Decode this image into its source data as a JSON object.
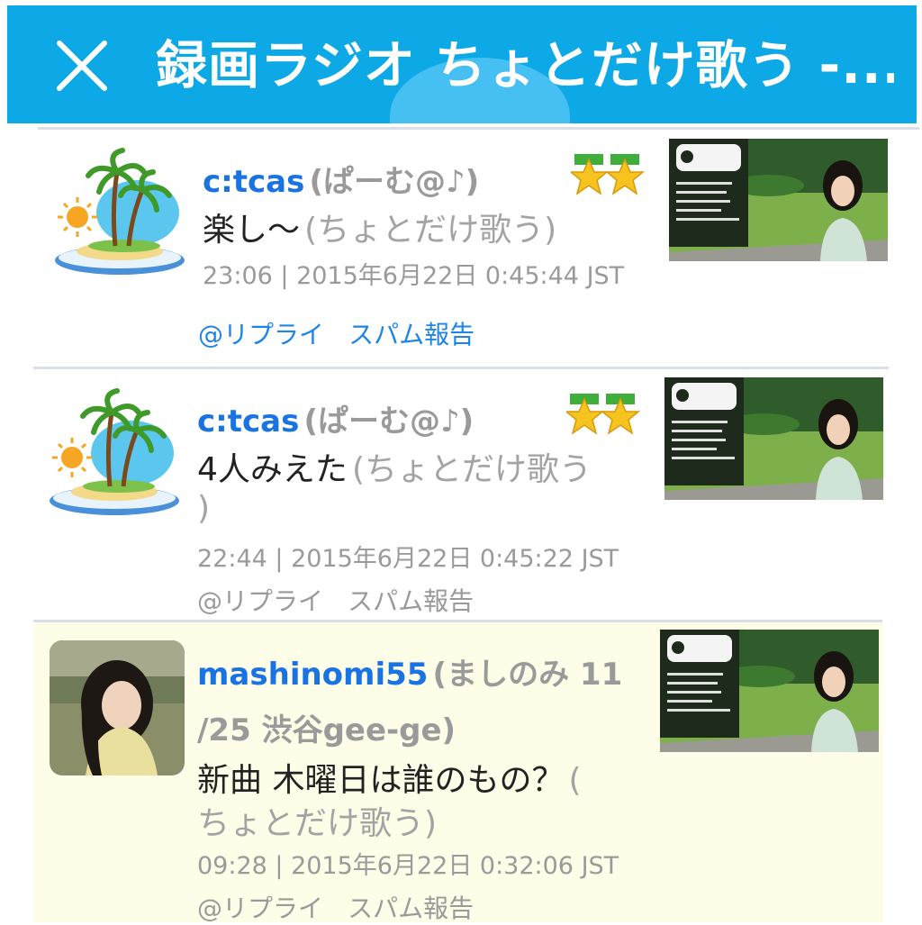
{
  "header": {
    "title": "録画ラジオ ちょとだけ歌う -...",
    "close_icon": "close-icon",
    "bg_color": "#0da8e6"
  },
  "feed": [
    {
      "username": "c:tcas",
      "nickname": "(ぱーむ@♪)",
      "message": "楽し〜",
      "source": "(ちょとだけ歌う)",
      "meta": "23:06 | 2015年6月22日 0:45:44 JST",
      "reply_label": "@リプライ",
      "spam_label": "スパム報告",
      "avatar_icon": "palm-island-icon",
      "badge_icon": "double-star-badge-icon"
    },
    {
      "username": "c:tcas",
      "nickname": "(ぱーむ@♪)",
      "message": "4人みえた",
      "source_line1": "(ちょとだけ歌う",
      "source_line2": ")",
      "meta": "22:44 | 2015年6月22日 0:45:22 JST",
      "reply_label": "@リプライ",
      "spam_label": "スパム報告",
      "avatar_icon": "palm-island-icon",
      "badge_icon": "double-star-badge-icon"
    },
    {
      "username": "mashinomi55",
      "nickname_line1": "(ましのみ 11",
      "nickname_line2": "/25 渋谷gee-ge)",
      "message": "新曲 木曜日は誰のもの？",
      "source_line1": "(",
      "source_line2": "ちょとだけ歌う)",
      "meta": "09:28 | 2015年6月22日 0:32:06 JST",
      "reply_label": "@リプライ",
      "spam_label": "スパム報告",
      "highlight_color": "#fdfde8"
    }
  ]
}
